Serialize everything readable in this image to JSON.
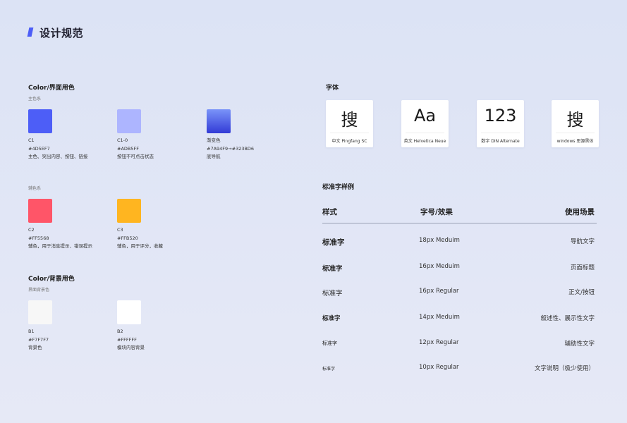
{
  "page": {
    "title": "设计规范"
  },
  "color_section": {
    "title": "Color/界面用色",
    "primary_group": "主色系",
    "primary": [
      {
        "id": "C1",
        "value": "#4D5EF7",
        "usage": "主色、突出内容、按钮、链接",
        "color": "#4d5ef7"
      },
      {
        "id": "C1-0",
        "value": "#ADB5FF",
        "usage": "按钮不可点击状态",
        "color": "#adb5ff"
      },
      {
        "id": "渐变色",
        "value": "#7A94F9→#323BD6",
        "usage": "底导航",
        "color_from": "#7a94f9",
        "color_to": "#323bd6"
      }
    ],
    "secondary_group": "辅色系",
    "secondary": [
      {
        "id": "C2",
        "value": "#FF5568",
        "usage": "辅色，用于消息提示、错误提示",
        "color": "#ff5568"
      },
      {
        "id": "C3",
        "value": "#FFB520",
        "usage": "辅色，用于评分，收藏",
        "color": "#ffb520"
      }
    ]
  },
  "bg_section": {
    "title": "Color/背景用色",
    "group": "界面背景色",
    "items": [
      {
        "id": "B1",
        "value": "#F7F7F7",
        "usage": "背景色",
        "color": "#f7f7f7"
      },
      {
        "id": "B2",
        "value": "#FFFFFF",
        "usage": "模块内容背景",
        "color": "#ffffff"
      }
    ]
  },
  "font_section": {
    "title": "字体",
    "cards": [
      {
        "glyph": "搜",
        "caption": "中文 Pingfang SC"
      },
      {
        "glyph": "Aa",
        "caption": "英文 Helvetica Neue"
      },
      {
        "glyph": "123",
        "caption": "数字 DIN Alternate"
      },
      {
        "glyph": "搜",
        "caption": "windows 思源黑体"
      }
    ]
  },
  "type_section": {
    "title": "标准字样例",
    "headers": {
      "style": "样式",
      "size": "字号/效果",
      "usage": "使用场景"
    },
    "rows": [
      {
        "sample": "标准字",
        "size": "18px Meduim",
        "usage": "导航文字"
      },
      {
        "sample": "标准字",
        "size": "16px Meduim",
        "usage": "页面标题"
      },
      {
        "sample": "标准字",
        "size": "16px Regular",
        "usage": "正文/按钮"
      },
      {
        "sample": "标准字",
        "size": "14px Meduim",
        "usage": "叙述性、展示性文字"
      },
      {
        "sample": "标准字",
        "size": "12px Regular",
        "usage": "辅助性文字"
      },
      {
        "sample": "标准字",
        "size": "10px Regular",
        "usage": "文字说明（极少使用）"
      }
    ]
  }
}
